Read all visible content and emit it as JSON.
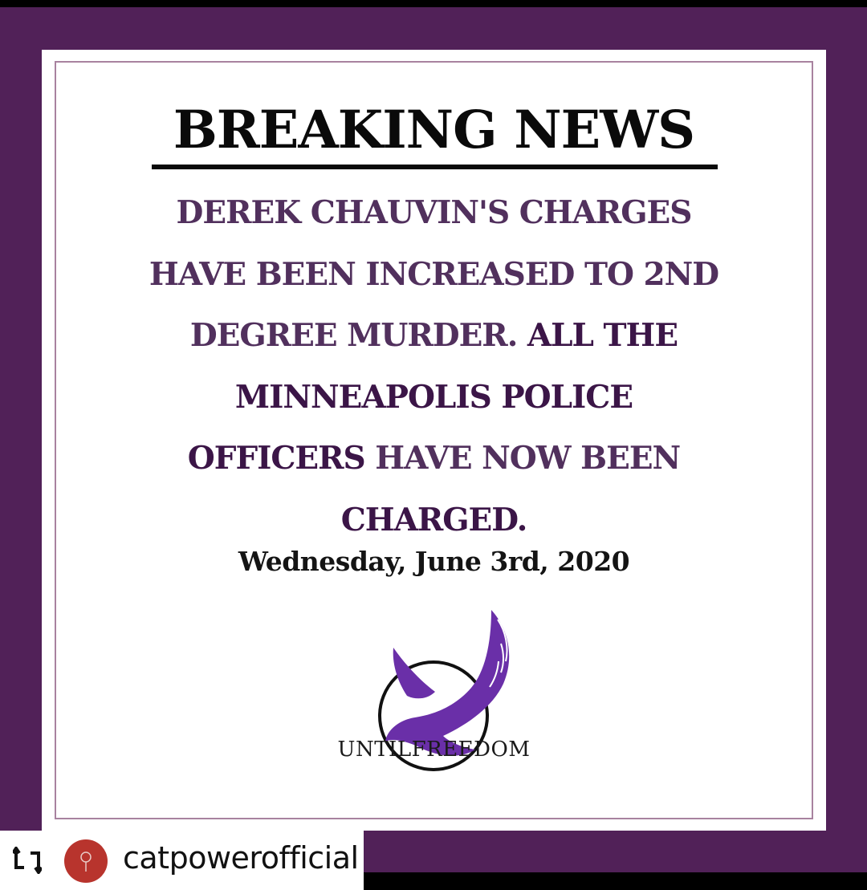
{
  "post": {
    "headline": "BREAKING NEWS",
    "body": {
      "line1": "DEREK CHAUVIN'S CHARGES",
      "line2": "HAVE BEEN INCREASED TO 2ND",
      "line3a": "DEGREE MURDER. ",
      "line3b": "ALL THE",
      "line4": "MINNEAPOLIS POLICE",
      "line5a": "OFFICERS",
      "line5b": " HAVE NOW BEEN",
      "line6": "CHARGED."
    },
    "date": "Wednesday, June 3rd, 2020",
    "logo": {
      "text": "UNTILFREEDOM",
      "icon": "bird-in-circle-logo"
    }
  },
  "repost": {
    "icon": "repost-icon",
    "avatar": "avatar",
    "username": "catpowerofficial"
  },
  "colors": {
    "frame": "#512158",
    "body_text": "#51305d",
    "logo_purple": "#6a2fa8",
    "avatar": "#b8342d"
  }
}
